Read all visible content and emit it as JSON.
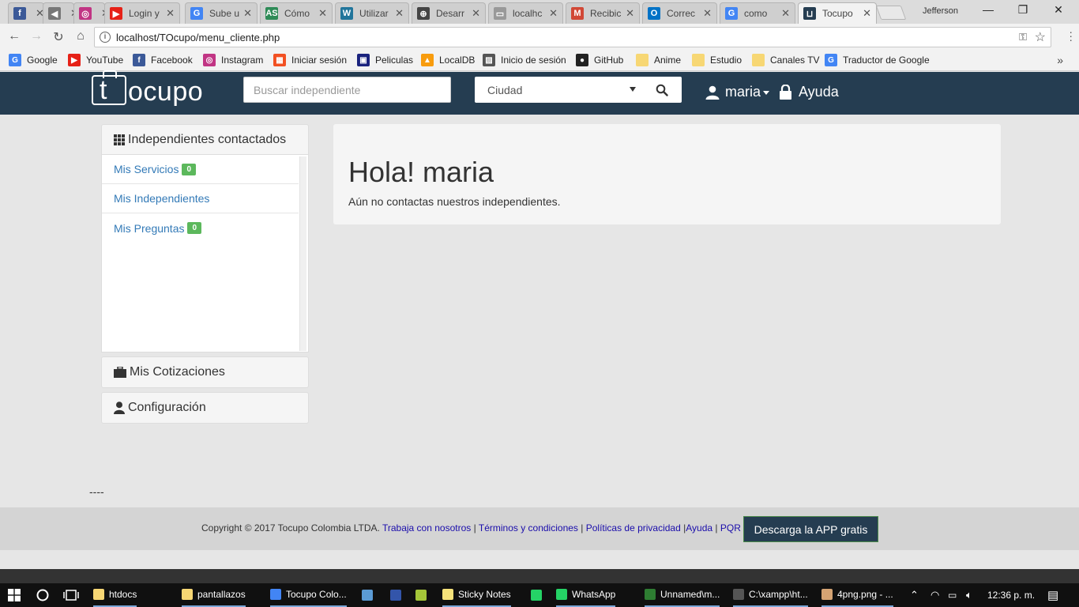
{
  "browser": {
    "tabs": [
      {
        "label": "",
        "icon": "facebook-icon",
        "color": "#3b5998",
        "glyph": "f"
      },
      {
        "label": "",
        "icon": "speaker-icon",
        "color": "#777777",
        "glyph": "◀"
      },
      {
        "label": "",
        "icon": "instagram-icon",
        "color": "#c13584",
        "glyph": "◎"
      },
      {
        "label": "Login y",
        "icon": "youtube-icon",
        "color": "#e62117",
        "glyph": "▶"
      },
      {
        "label": "Sube u",
        "icon": "google-icon",
        "color": "#4285f4",
        "glyph": "G"
      },
      {
        "label": "Cómo",
        "icon": "site-icon",
        "color": "#2e8b57",
        "glyph": "AS"
      },
      {
        "label": "Utilizar",
        "icon": "wordpress-icon",
        "color": "#21759b",
        "glyph": "W"
      },
      {
        "label": "Desarr",
        "icon": "network-icon",
        "color": "#444444",
        "glyph": "⊕"
      },
      {
        "label": "localhc",
        "icon": "page-icon",
        "color": "#999999",
        "glyph": "▭"
      },
      {
        "label": "Recibic",
        "icon": "gmail-icon",
        "color": "#d14836",
        "glyph": "M"
      },
      {
        "label": "Correc",
        "icon": "outlook-icon",
        "color": "#0072c6",
        "glyph": "O"
      },
      {
        "label": "como",
        "icon": "google-icon",
        "color": "#4285f4",
        "glyph": "G"
      },
      {
        "label": "Tocupo",
        "icon": "tocupo-icon",
        "color": "#253d51",
        "glyph": "⊔"
      }
    ],
    "profile_name": "Jefferson",
    "url": "localhost/TOcupo/menu_cliente.php",
    "bookmarks": [
      {
        "label": "Google",
        "icon": "google-icon",
        "color": "#4285f4",
        "glyph": "G"
      },
      {
        "label": "YouTube",
        "icon": "youtube-icon",
        "color": "#e62117",
        "glyph": "▶"
      },
      {
        "label": "Facebook",
        "icon": "facebook-icon",
        "color": "#3b5998",
        "glyph": "f"
      },
      {
        "label": "Instagram",
        "icon": "instagram-icon",
        "color": "#c13584",
        "glyph": "◎"
      },
      {
        "label": "Iniciar sesión",
        "icon": "microsoft-icon",
        "color": "#f25022",
        "glyph": "▦"
      },
      {
        "label": "Peliculas",
        "icon": "clapper-icon",
        "color": "#1a237e",
        "glyph": "▣"
      },
      {
        "label": "LocalDB",
        "icon": "phpmyadmin-icon",
        "color": "#f89c0e",
        "glyph": "▲"
      },
      {
        "label": "Inicio de sesión",
        "icon": "image-icon",
        "color": "#555555",
        "glyph": "▨"
      },
      {
        "label": "GitHub",
        "icon": "github-icon",
        "color": "#222222",
        "glyph": "●"
      },
      {
        "label": "Anime",
        "icon": "folder-icon",
        "color": "#f7d774",
        "glyph": ""
      },
      {
        "label": "Estudio",
        "icon": "folder-icon",
        "color": "#f7d774",
        "glyph": ""
      },
      {
        "label": "Canales TV",
        "icon": "folder-icon",
        "color": "#f7d774",
        "glyph": ""
      },
      {
        "label": "Traductor de Google",
        "icon": "translate-icon",
        "color": "#4285f4",
        "glyph": "G"
      }
    ]
  },
  "site": {
    "logo_text": "ocupo",
    "logo_letter": "t",
    "search_placeholder": "Buscar independiente",
    "city_label": "Ciudad",
    "user_name": "maria",
    "help_label": "Ayuda",
    "brand_color": "#253d51"
  },
  "sidebar": {
    "contacted_title": "Independientes contactados",
    "items": [
      {
        "label": "Mis Servicios",
        "badge": "0"
      },
      {
        "label": "Mis Independientes",
        "badge": ""
      },
      {
        "label": "Mis Preguntas",
        "badge": "0"
      }
    ],
    "quotes_title": "Mis Cotizaciones",
    "config_title": "Configuración"
  },
  "main": {
    "greeting": "Hola! maria",
    "message": "Aún no contactas nuestros independientes."
  },
  "dashes": "----",
  "footer": {
    "copyright": "Copyright © 2017 Tocupo Colombia LTDA.",
    "links": [
      "Trabaja con nosotros",
      "Términos y condiciones",
      "Políticas de privacidad",
      "Ayuda",
      "PQR"
    ],
    "app_button": "Descarga la APP gratis"
  },
  "taskbar": {
    "items": [
      {
        "label": "htdocs",
        "icon": "folder-icon",
        "color": "#f7d774"
      },
      {
        "label": "pantallazos",
        "icon": "folder-icon",
        "color": "#f7d774"
      },
      {
        "label": "Tocupo Colo...",
        "icon": "chrome-icon",
        "color": "#4285f4"
      },
      {
        "label": "",
        "icon": "cube-icon",
        "color": "#5b9bd5"
      },
      {
        "label": "",
        "icon": "flag-icon",
        "color": "#3355aa"
      },
      {
        "label": "",
        "icon": "android-icon",
        "color": "#a4c639"
      },
      {
        "label": "Sticky Notes",
        "icon": "sticky-notes-icon",
        "color": "#f6e27a"
      },
      {
        "label": "",
        "icon": "whatsapp-icon",
        "color": "#25d366"
      },
      {
        "label": "WhatsApp",
        "icon": "whatsapp-icon",
        "color": "#25d366"
      },
      {
        "label": "Unnamed\\m...",
        "icon": "editor-icon",
        "color": "#2e7d32"
      },
      {
        "label": "C:\\xampp\\ht...",
        "icon": "terminal-icon",
        "color": "#555555"
      },
      {
        "label": "4png.png - ...",
        "icon": "paint-icon",
        "color": "#d4a373"
      }
    ],
    "clock": "12:36 p. m."
  }
}
